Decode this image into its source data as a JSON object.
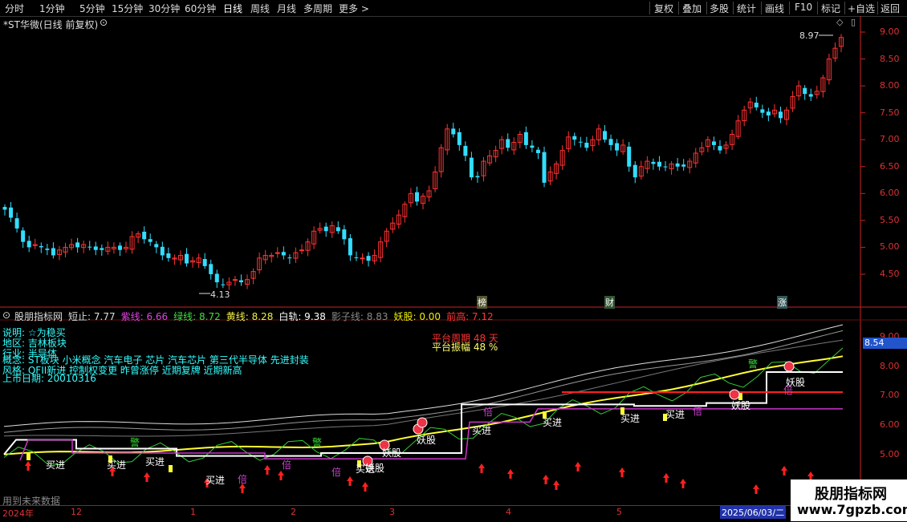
{
  "toolbar": {
    "left": [
      "分时",
      "1分钟",
      "5分钟",
      "15分钟",
      "30分钟",
      "60分钟",
      "日线",
      "周线",
      "月线",
      "多周期",
      "更多 >"
    ],
    "right": [
      "复权",
      "叠加",
      "多股",
      "统计",
      "画线",
      "F10",
      "+自选",
      "返回"
    ]
  },
  "main_chart": {
    "title": "*ST华微(日线 前复权)",
    "price_labels": [
      "9.00",
      "8.50",
      "8.00",
      "7.50",
      "7.00",
      "6.50",
      "6.00",
      "5.50",
      "5.00",
      "4.50"
    ],
    "high_mark": "8.97",
    "low_mark": "4.13",
    "markers": [
      "榜",
      "财",
      "涨"
    ]
  },
  "indicator": {
    "header": [
      {
        "label": "股朋指标网",
        "color": "#dddddd"
      },
      {
        "label": "短止: 7.77",
        "color": "#dddddd"
      },
      {
        "label": "紫线: 6.66",
        "color": "#dd44dd"
      },
      {
        "label": "绿线: 8.72",
        "color": "#44dd44"
      },
      {
        "label": "黄线: 8.28",
        "color": "#eeee44"
      },
      {
        "label": "白轨: 9.38",
        "color": "#ffffff"
      },
      {
        "label": "影子线: 8.83",
        "color": "#888888"
      },
      {
        "label": "妖股: 0.00",
        "color": "#eeee00"
      },
      {
        "label": "前高: 7.12",
        "color": "#ff3333"
      }
    ],
    "price_labels": [
      "9.00",
      "8.00",
      "7.00",
      "6.00",
      "5.00"
    ],
    "current_value": "8.54",
    "info_lines": [
      "说明: ☆为稳买",
      "地区:    吉林板块",
      "行业:    半导体",
      "概念:    ST板块 小米概念 汽车电子 芯片 汽车芯片 第三代半导体 先进封装",
      "风格:    QFII新进 控制权变更 昨曾涨停 近期复牌 近期新高",
      "上市日期: 20010316"
    ],
    "platform_period": "平台周期 48 天",
    "platform_amplitude": "平台振幅 48 %",
    "buy_label": "买进",
    "demon_label": "妖股",
    "warn_label": "警",
    "double_label": "倍",
    "footer_note": "用到未来数据"
  },
  "date_axis": {
    "labels": [
      "2024年",
      "12",
      "1",
      "2",
      "3",
      "4",
      "5",
      "2025/06/03/二"
    ]
  },
  "watermark": {
    "title": "股朋指标网",
    "url": "www.7gpzb.com"
  },
  "colors": {
    "up": "#ff3333",
    "down": "#33ddff",
    "yellow": "#ffff33",
    "white": "#ffffff",
    "purple": "#cc33cc",
    "green": "#33cc33",
    "red_line": "#ff2020"
  }
}
